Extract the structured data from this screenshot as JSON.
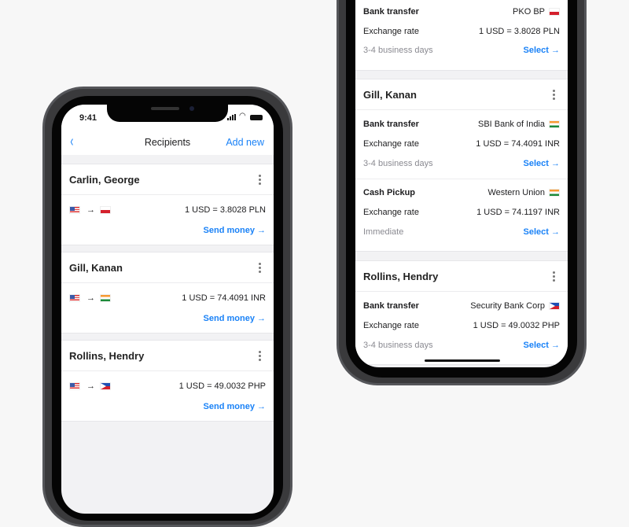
{
  "left": {
    "status": {
      "time": "9:41"
    },
    "nav": {
      "title": "Recipients",
      "add_new": "Add new"
    },
    "recipients": [
      {
        "name": "Carlin, George",
        "from_flag": "us",
        "to_flag": "pl",
        "rate": "1 USD = 3.8028 PLN",
        "action": "Send money"
      },
      {
        "name": "Gill, Kanan",
        "from_flag": "us",
        "to_flag": "in",
        "rate": "1 USD = 74.4091 INR",
        "action": "Send money"
      },
      {
        "name": "Rollins, Hendry",
        "from_flag": "us",
        "to_flag": "ph",
        "rate": "1 USD = 49.0032 PHP",
        "action": "Send money"
      }
    ]
  },
  "right": {
    "top_option": {
      "method": "Bank transfer",
      "provider": "PKO BP",
      "flag": "pl",
      "rate_label": "Exchange rate",
      "rate": "1 USD = 3.8028 PLN",
      "time": "3-4 business days",
      "action": "Select"
    },
    "recipients": [
      {
        "name": "Gill, Kanan",
        "options": [
          {
            "method": "Bank transfer",
            "provider": "SBI Bank of India",
            "flag": "in",
            "rate_label": "Exchange rate",
            "rate": "1 USD = 74.4091 INR",
            "time": "3-4 business days",
            "action": "Select"
          },
          {
            "method": "Cash Pickup",
            "provider": "Western Union",
            "flag": "in",
            "rate_label": "Exchange rate",
            "rate": "1 USD = 74.1197 INR",
            "time": "Immediate",
            "action": "Select"
          }
        ]
      },
      {
        "name": "Rollins, Hendry",
        "options": [
          {
            "method": "Bank transfer",
            "provider": "Security Bank Corp",
            "flag": "ph",
            "rate_label": "Exchange rate",
            "rate": "1 USD = 49.0032 PHP",
            "time": "3-4 business days",
            "action": "Select"
          }
        ]
      }
    ]
  },
  "colors": {
    "accent": "#1a82f7",
    "background": "#f7f7f7"
  }
}
